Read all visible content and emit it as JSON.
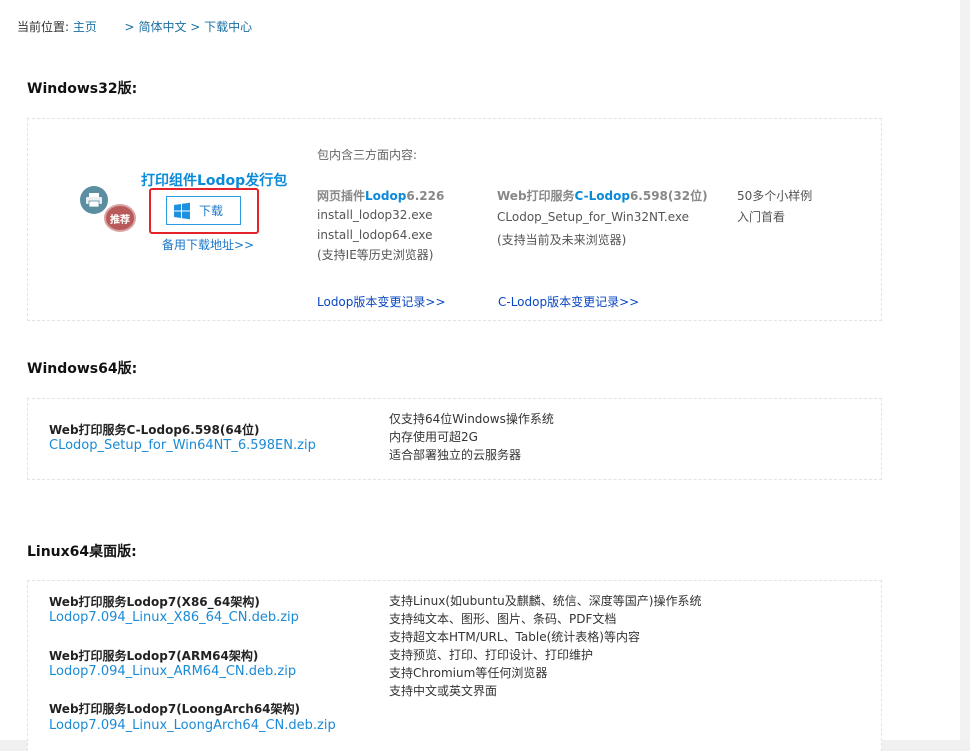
{
  "breadcrumb": {
    "label": "当前位置:",
    "home": "主页",
    "sep1": ">",
    "lang": "简体中文",
    "sep2": ">",
    "current": "下载中心"
  },
  "win32": {
    "title": "Windows32版:",
    "product_title": "打印组件Lodop发行包",
    "badge": "推荐",
    "download_label": "下载",
    "backup_link": "备用下载地址>>",
    "contents_label": "包内含三方面内容:",
    "col1": {
      "title_prefix": "网页插件",
      "title_brand": "Lodop",
      "title_version": "6.226",
      "lines": [
        "install_lodop32.exe",
        "install_lodop64.exe",
        "(支持IE等历史浏览器)"
      ],
      "changelog": "Lodop版本变更记录>>"
    },
    "col2": {
      "title_prefix": "Web打印服务",
      "title_brand": "C-Lodop",
      "title_version": "6.598(32位)",
      "lines": [
        "CLodop_Setup_for_Win32NT.exe",
        "(支持当前及未来浏览器)"
      ],
      "changelog": "C-Lodop版本变更记录>>"
    },
    "col3": {
      "lines": [
        "50多个小样例",
        "入门首看"
      ]
    }
  },
  "win64": {
    "title": "Windows64版:",
    "item_title": "Web打印服务C-Lodop6.598(64位)",
    "item_file": "CLodop_Setup_for_Win64NT_6.598EN.zip",
    "notes": [
      "仅支持64位Windows操作系统",
      "内存使用可超2G",
      "适合部署独立的云服务器"
    ]
  },
  "linux": {
    "title": "Linux64桌面版:",
    "items": [
      {
        "title": "Web打印服务Lodop7(X86_64架构)",
        "file": "Lodop7.094_Linux_X86_64_CN.deb.zip"
      },
      {
        "title": "Web打印服务Lodop7(ARM64架构)",
        "file": "Lodop7.094_Linux_ARM64_CN.deb.zip"
      },
      {
        "title": "Web打印服务Lodop7(LoongArch64架构)",
        "file": "Lodop7.094_Linux_LoongArch64_CN.deb.zip"
      }
    ],
    "notes": [
      "支持Linux(如ubuntu及麒麟、统信、深度等国产)操作系统",
      "支持纯文本、图形、图片、条码、PDF文档",
      "支持超文本HTM/URL、Table(统计表格)等内容",
      "支持预览、打印、打印设计、打印维护",
      "支持Chromium等任何浏览器",
      "支持中文或英文界面"
    ]
  },
  "colors": {
    "accent_blue": "#0a8ad9",
    "link_blue": "#0a47c2",
    "highlight_red": "#e5232a",
    "badge_red": "#b85a5a"
  }
}
